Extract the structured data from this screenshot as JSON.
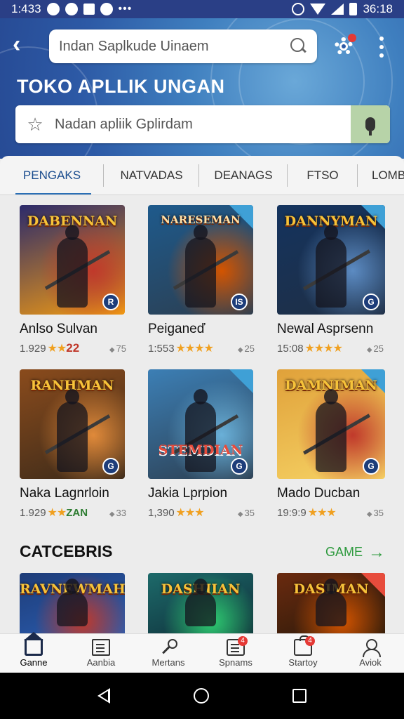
{
  "status_bar": {
    "time": "1:433",
    "time_right": "36:18"
  },
  "header": {
    "top_search_placeholder": "Indan Saplkude Uinaem",
    "store_title": "TOKO APLLIK UNGAN",
    "app_search_placeholder": "Nadan apliik Gplirdam"
  },
  "tabs": [
    {
      "label": "PENGAKS",
      "active": true
    },
    {
      "label": "NATVADAS",
      "active": false
    },
    {
      "label": "DEANAGS",
      "active": false
    },
    {
      "label": "FTSO",
      "active": false
    },
    {
      "label": "LOMB",
      "active": false
    }
  ],
  "games": [
    {
      "art_title": "DABENNAN",
      "name": "Anlso Sulvan",
      "rating_text": "1.929",
      "stars": "★★",
      "extra": "22",
      "downloads": "75",
      "badge": "R",
      "colors": [
        "#2b2a6b",
        "#c0392b",
        "#f39c12"
      ]
    },
    {
      "art_title": "NARESEMAN",
      "name": "Peiganeď",
      "rating_text": "1:553",
      "stars": "★★★★",
      "extra": "",
      "downloads": "25",
      "badge": "IS",
      "colors": [
        "#1e5a8c",
        "#d35400",
        "#2c3e50"
      ]
    },
    {
      "art_title": "DANNYMAN",
      "name": "Newal Asprsenn",
      "rating_text": "15:08",
      "stars": "★★★★",
      "extra": "",
      "downloads": "25",
      "badge": "G",
      "colors": [
        "#14335e",
        "#5c8bc2",
        "#1f2f45"
      ]
    },
    {
      "art_title": "RANHMAN",
      "name": "Naka Lagnrloin",
      "rating_text": "1.929",
      "stars": "★★",
      "extra": "ZAN",
      "downloads": "33",
      "badge": "G",
      "colors": [
        "#8a4b1c",
        "#e08a3a",
        "#3b2a1a"
      ]
    },
    {
      "art_title": "STEMDIAN",
      "name": "Jakia Lprpion",
      "rating_text": "1,390",
      "stars": "★★★",
      "extra": "",
      "downloads": "35",
      "badge": "G",
      "colors": [
        "#3c7fb5",
        "#6ab0d8",
        "#2c3e50"
      ]
    },
    {
      "art_title": "DAMNIMAN",
      "name": "Mado Ducban",
      "rating_text": "19:9:9",
      "stars": "★★★",
      "extra": "",
      "downloads": "35",
      "badge": "G",
      "colors": [
        "#e0a13a",
        "#c0392b",
        "#f6d365"
      ]
    }
  ],
  "categories": {
    "title": "CATCEBRIS",
    "link": "GAME",
    "items": [
      {
        "art_title": "RAVNEWMAH",
        "colors": [
          "#1e3c78",
          "#c0392b",
          "#2a5db0"
        ]
      },
      {
        "art_title": "DASHIIAN",
        "colors": [
          "#1d6a6a",
          "#2ecc71",
          "#0f2f3a"
        ]
      },
      {
        "art_title": "DASIMAN",
        "colors": [
          "#6a2a0f",
          "#d35400",
          "#2a1a0a"
        ]
      }
    ]
  },
  "bottom_nav": [
    {
      "label": "Ganne",
      "icon": "home-icon",
      "active": true
    },
    {
      "label": "Aanbia",
      "icon": "book-icon",
      "active": false
    },
    {
      "label": "Mertans",
      "icon": "key-icon",
      "active": false
    },
    {
      "label": "Spnams",
      "icon": "list-icon",
      "badge": "4",
      "active": false
    },
    {
      "label": "Startoy",
      "icon": "bag-icon",
      "badge": "4",
      "active": false
    },
    {
      "label": "Aviok",
      "icon": "user-icon",
      "active": false
    }
  ]
}
